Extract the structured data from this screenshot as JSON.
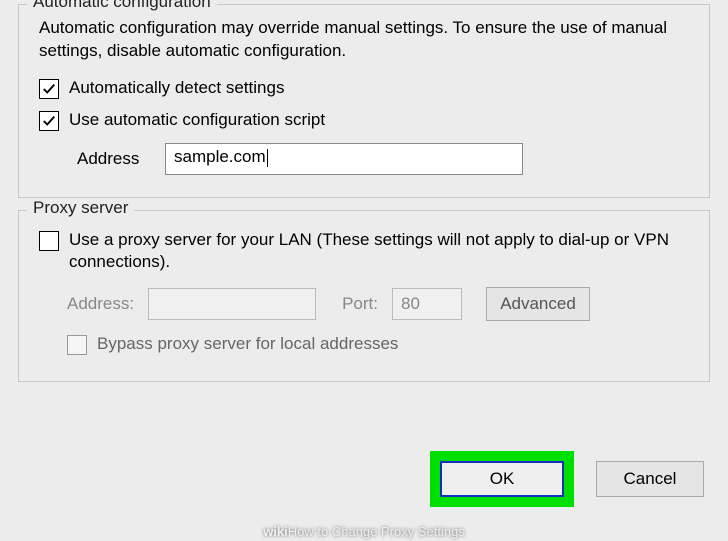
{
  "auto": {
    "legend": "Automatic configuration",
    "help": "Automatic configuration may override manual settings.  To ensure the use of manual settings, disable automatic configuration.",
    "detect_label": "Automatically detect settings",
    "detect_checked": true,
    "script_label": "Use automatic configuration script",
    "script_checked": true,
    "address_label": "Address",
    "address_value": "sample.com"
  },
  "proxy": {
    "legend": "Proxy server",
    "use_label": "Use a proxy server for your LAN (These settings will not apply to dial-up or VPN connections).",
    "use_checked": false,
    "address_label": "Address:",
    "address_value": "",
    "port_label": "Port:",
    "port_value": "80",
    "advanced_label": "Advanced",
    "bypass_label": "Bypass proxy server for local addresses",
    "bypass_checked": false
  },
  "buttons": {
    "ok": "OK",
    "cancel": "Cancel"
  },
  "watermark": {
    "brand": "wiki",
    "rest": "How to Change Proxy Settings"
  }
}
